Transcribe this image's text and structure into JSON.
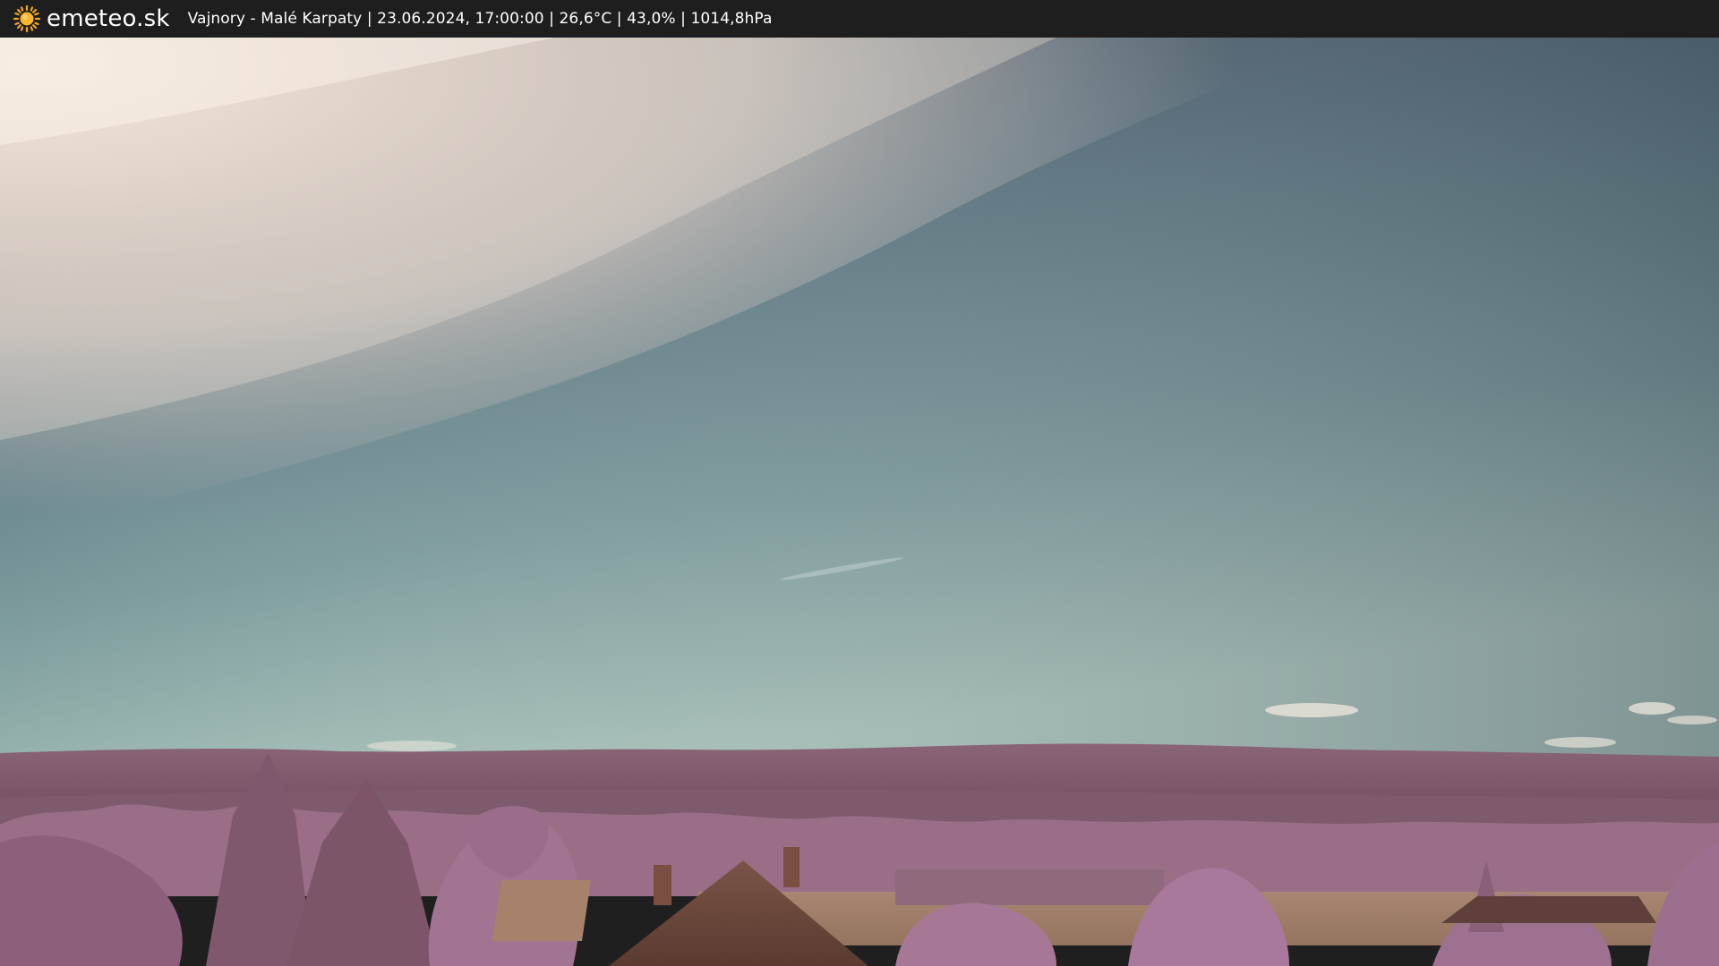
{
  "header": {
    "brand": "emeteo.sk",
    "caption": "Vajnory - Malé Karpaty | 23.06.2024, 17:00:00 | 26,6°C | 43,0% | 1014,8hPa"
  },
  "icons": {
    "brand": "sun-icon"
  },
  "colors": {
    "topbar": "#1e1e1e",
    "sun": "#f5a623",
    "sky_top": "#4a5a68",
    "sky_mid": "#6f8d93",
    "sky_horizon": "#a8c2bb",
    "hills": "#7c5a6b",
    "trees": "#9a6a85"
  }
}
